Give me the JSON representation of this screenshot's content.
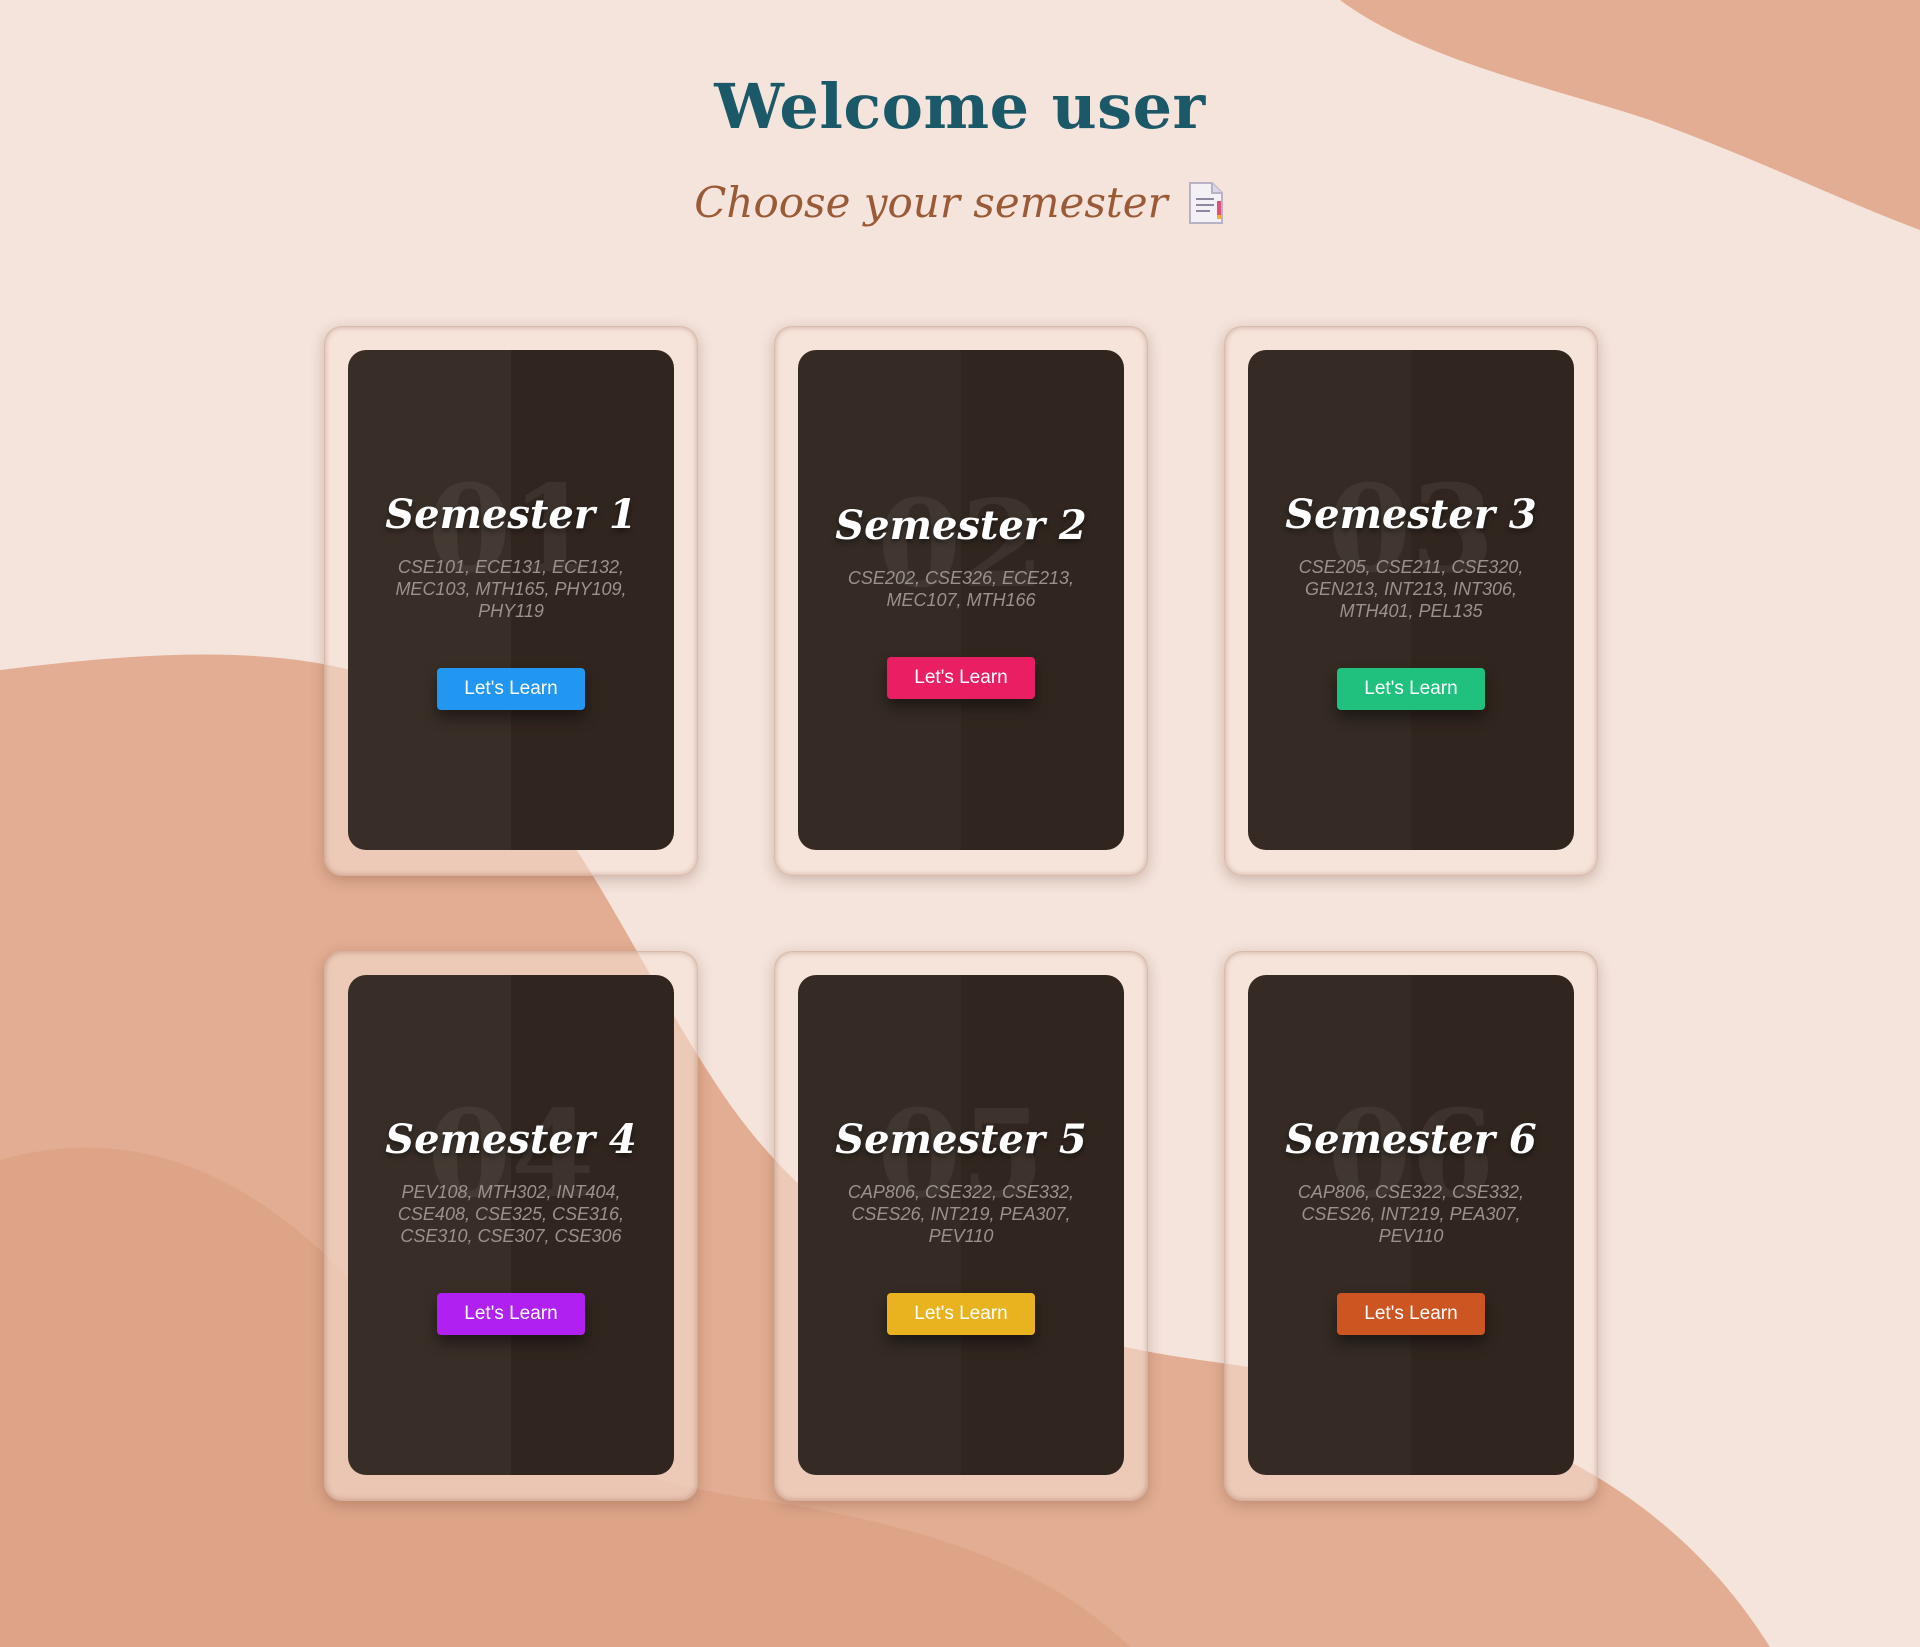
{
  "header": {
    "title": "Welcome user",
    "subtitle": "Choose your semester"
  },
  "icons": {
    "subtitle_icon": "document-icon"
  },
  "semesters": [
    {
      "number": "01",
      "title": "Semester 1",
      "courses": "CSE101, ECE131, ECE132, MEC103, MTH165, PHY109, PHY119",
      "button": "Let's Learn",
      "button_color": "#2196f3"
    },
    {
      "number": "02",
      "title": "Semester 2",
      "courses": "CSE202, CSE326, ECE213, MEC107, MTH166",
      "button": "Let's Learn",
      "button_color": "#e91e63"
    },
    {
      "number": "03",
      "title": "Semester 3",
      "courses": "CSE205, CSE211, CSE320, GEN213, INT213, INT306, MTH401, PEL135",
      "button": "Let's Learn",
      "button_color": "#20c07f"
    },
    {
      "number": "04",
      "title": "Semester 4",
      "courses": "PEV108, MTH302, INT404, CSE408, CSE325, CSE316, CSE310, CSE307, CSE306",
      "button": "Let's Learn",
      "button_color": "#b020f0"
    },
    {
      "number": "05",
      "title": "Semester 5",
      "courses": "CAP806, CSE322, CSE332, CSES26, INT219, PEA307, PEV110",
      "button": "Let's Learn",
      "button_color": "#e9b31f"
    },
    {
      "number": "06",
      "title": "Semester 6",
      "courses": "CAP806, CSE322, CSE332, CSES26, INT219, PEA307, PEV110",
      "button": "Let's Learn",
      "button_color": "#cc5522"
    }
  ]
}
